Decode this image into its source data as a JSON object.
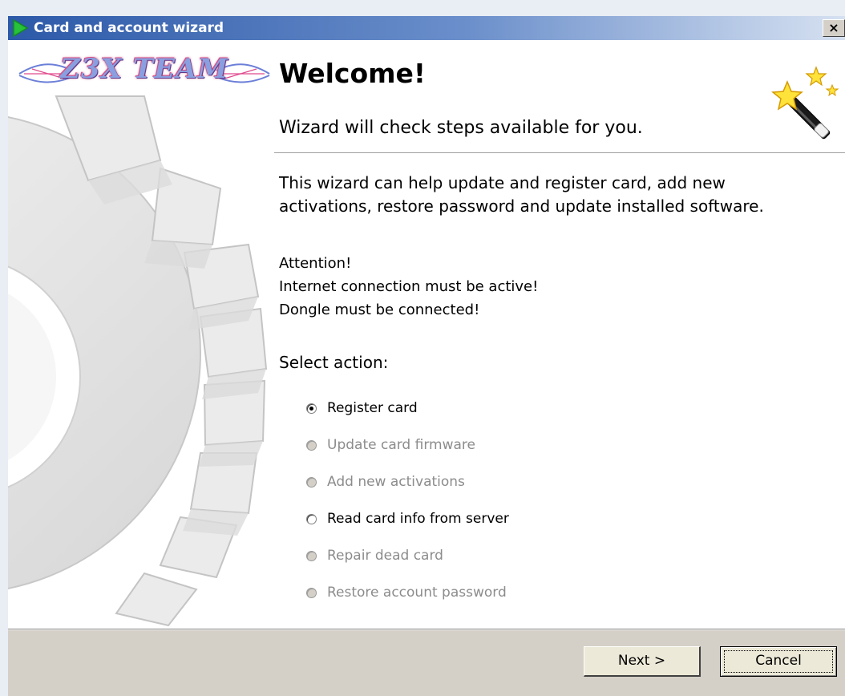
{
  "window": {
    "title": "Card and account wizard",
    "close_label": "×"
  },
  "logo": {
    "text": "Z3X TEAM"
  },
  "header": {
    "title": "Welcome!",
    "subtitle": "Wizard will check steps available for you."
  },
  "body": {
    "description": [
      "This wizard can help update and register card, add new",
      "activations, restore password and update installed software."
    ],
    "attention": [
      "Attention!",
      "Internet connection must be active!",
      "Dongle must be connected!"
    ],
    "select_label": "Select action:"
  },
  "options": [
    {
      "label": "Register card",
      "checked": true,
      "enabled": true
    },
    {
      "label": "Update card firmware",
      "checked": false,
      "enabled": false
    },
    {
      "label": "Add new activations",
      "checked": false,
      "enabled": false
    },
    {
      "label": "Read card info from server",
      "checked": false,
      "enabled": true
    },
    {
      "label": "Repair dead card",
      "checked": false,
      "enabled": false
    },
    {
      "label": "Restore account password",
      "checked": false,
      "enabled": false
    }
  ],
  "buttons": {
    "next": "Next >",
    "cancel": "Cancel"
  },
  "icons": {
    "title": "green-play-arrow-icon",
    "header": "magic-wand-icon",
    "close": "close-icon"
  },
  "colors": {
    "titlebar_start": "#2c59a8",
    "titlebar_end": "#d6e1f1",
    "dialog_face": "#d4d0c8",
    "disabled_text": "#8c8c8c"
  }
}
